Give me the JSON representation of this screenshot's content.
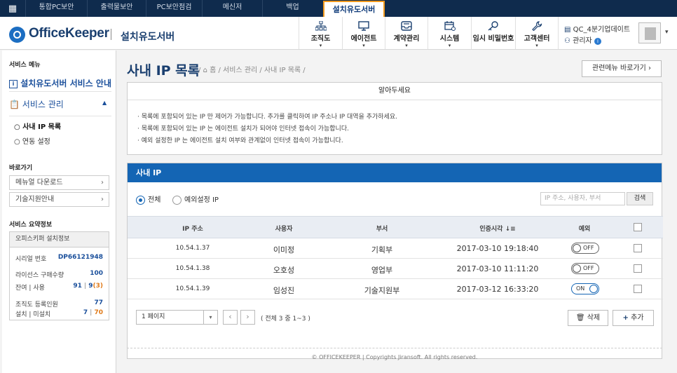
{
  "topbar": {
    "grid_icon": "apps-grid-icon",
    "tabs": [
      "통합PC보안",
      "출력물보안",
      "PC보안점검",
      "메신저",
      "백업",
      "설치유도서버"
    ],
    "active_tab": 5
  },
  "header": {
    "logo_text": "OfficeKeeper",
    "subtitle": "설치유도서버",
    "nav": [
      {
        "label": "조직도",
        "icon": "org-chart-icon"
      },
      {
        "label": "에이전트",
        "icon": "monitor-icon"
      },
      {
        "label": "계약관리",
        "icon": "inbox-icon"
      },
      {
        "label": "시스템",
        "icon": "calendar-gear-icon"
      },
      {
        "label": "임시 비밀번호",
        "icon": "key-icon"
      },
      {
        "label": "고객센터",
        "icon": "wrench-icon"
      }
    ],
    "company": "QC_4분기업데이트",
    "role": "관리자"
  },
  "sidebar": {
    "service_menu_heading": "서비스 메뉴",
    "guide": "설치유도서버 서비스 안내",
    "service_mgmt": "서비스 관리",
    "sub_items": [
      "사내 IP 목록",
      "연동 설정"
    ],
    "shortcuts_heading": "바로가기",
    "shortcuts": [
      "메뉴얼 다운로드",
      "기술지원안내"
    ],
    "summary_heading": "서비스 요약정보",
    "info_title": "오피스키퍼 설치정보",
    "serial_label": "시리얼 번호",
    "serial_value": "DP66121948",
    "license_label": "라이선스 구매수량",
    "license_value": "100",
    "remain_label": "잔여 | 사용",
    "remain_value": "91",
    "use_value": "9",
    "use_extra": "(3)",
    "org_label": "조직도 등록인원",
    "org_value": "77",
    "install_label": "설치 | 미설치",
    "installed": "7",
    "not_installed": "70"
  },
  "main": {
    "title": "사내 IP 목록",
    "breadcrumb": [
      "홈",
      "서비스 관리",
      "사내 IP 목록"
    ],
    "related_button": "관련메뉴 바로가기",
    "notice_title": "알아두세요",
    "notices": [
      "목록에 포함되어 있는 IP 만 제어가 가능합니다. 추가를 클릭하여 IP 주소나 IP 대역을 추가하세요.",
      "목록에 포함되어 있는 IP 는 에이전트 설치가 되어야 인터넷 접속이 가능합니다.",
      "예외 설정한 IP 는 에이전트 설치 여부와 관계없이 인터넷 접속이 가능합니다."
    ],
    "panel_title": "사내 IP",
    "filter_all": "전체",
    "filter_exception": "예외설정 IP",
    "search_placeholder": "IP 주소, 사용자, 부서",
    "search_button": "검색",
    "columns": [
      "IP 주소",
      "사용자",
      "부서",
      "인증시각 ↓≡",
      "예외"
    ],
    "rows": [
      {
        "ip": "10.54.1.37",
        "user": "이미정",
        "dept": "기획부",
        "time": "2017-03-10 19:18:40",
        "exception": "OFF"
      },
      {
        "ip": "10.54.1.38",
        "user": "오호성",
        "dept": "영업부",
        "time": "2017-03-10 11:11:20",
        "exception": "OFF"
      },
      {
        "ip": "10.54.1.39",
        "user": "임성진",
        "dept": "기술지원부",
        "time": "2017-03-12 16:33:20",
        "exception": "ON"
      }
    ],
    "page_select": "1 페이지",
    "page_info": "( 전체 3 중 1~3 )",
    "delete_button": "삭제",
    "add_button": "추가",
    "footer": "© OFFICEKEEPER | Copyrights Jiransoft. All rights reserved."
  },
  "colors": {
    "brand": "#1a3f6f",
    "accent": "#1465b4",
    "topbar": "#0f2b4d",
    "highlight": "#f29a1e"
  }
}
